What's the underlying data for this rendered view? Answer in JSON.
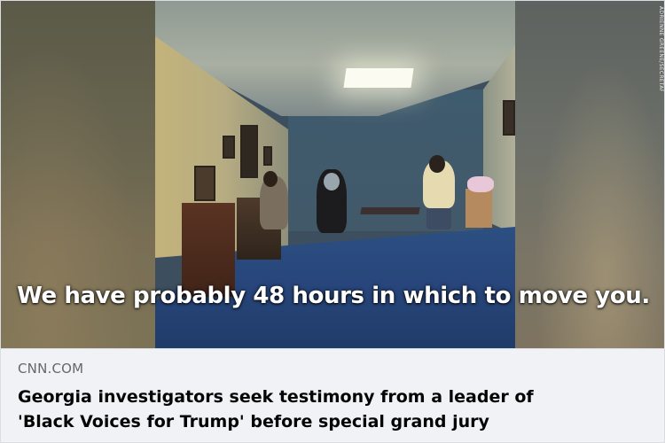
{
  "video": {
    "caption": "We have probably 48 hours in which to move you.",
    "credit": "ADRIENNE GREENE/SECRETARY OF STATE"
  },
  "link_preview": {
    "domain": "CNN.COM",
    "headline_line1": "Georgia investigators seek testimony from a leader of",
    "headline_line2": "'Black Voices for Trump' before special grand jury"
  }
}
